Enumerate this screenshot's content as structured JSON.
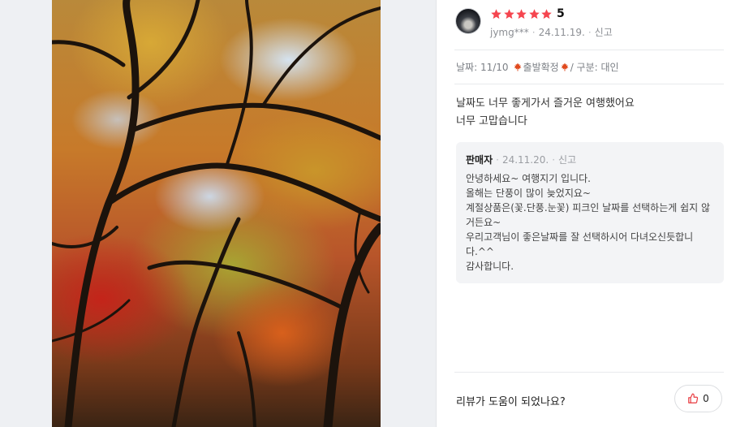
{
  "review": {
    "rating_stars": 5,
    "rating_label": "5",
    "user": "jymg***",
    "date": "24.11.19.",
    "report": "신고",
    "trip": {
      "date_label": "날짜: 11/10",
      "status": "출발확정",
      "type_label": "/ 구분: 대인"
    },
    "body_lines": [
      "날짜도 너무 좋게가서 즐거운 여행했어요",
      "너무 고맙습니다"
    ]
  },
  "reply": {
    "author": "판매자",
    "date": "24.11.20.",
    "report": "신고",
    "lines": [
      "안녕하세요~ 여행지기 입니다.",
      "올해는 단풍이 많이 늦었지요~",
      "계절상품은(꽃.단풍.눈꽃) 피크인 날짜를 선택하는게 쉽지 않",
      "거든요~",
      "우리고객님이 좋은날짜를  잘 선택하시어 다녀오신듯합니",
      "다.^^",
      "감사합니다."
    ]
  },
  "footer": {
    "helpful_question": "리뷰가 도움이 되었나요?",
    "like_count": "0"
  },
  "colors": {
    "star": "#f5454f",
    "leaf": "#e04a1e",
    "like_icon": "#e8383d"
  },
  "icons": {
    "star": "star-icon",
    "leaf": "maple-leaf-icon",
    "like": "thumbs-up-icon"
  }
}
